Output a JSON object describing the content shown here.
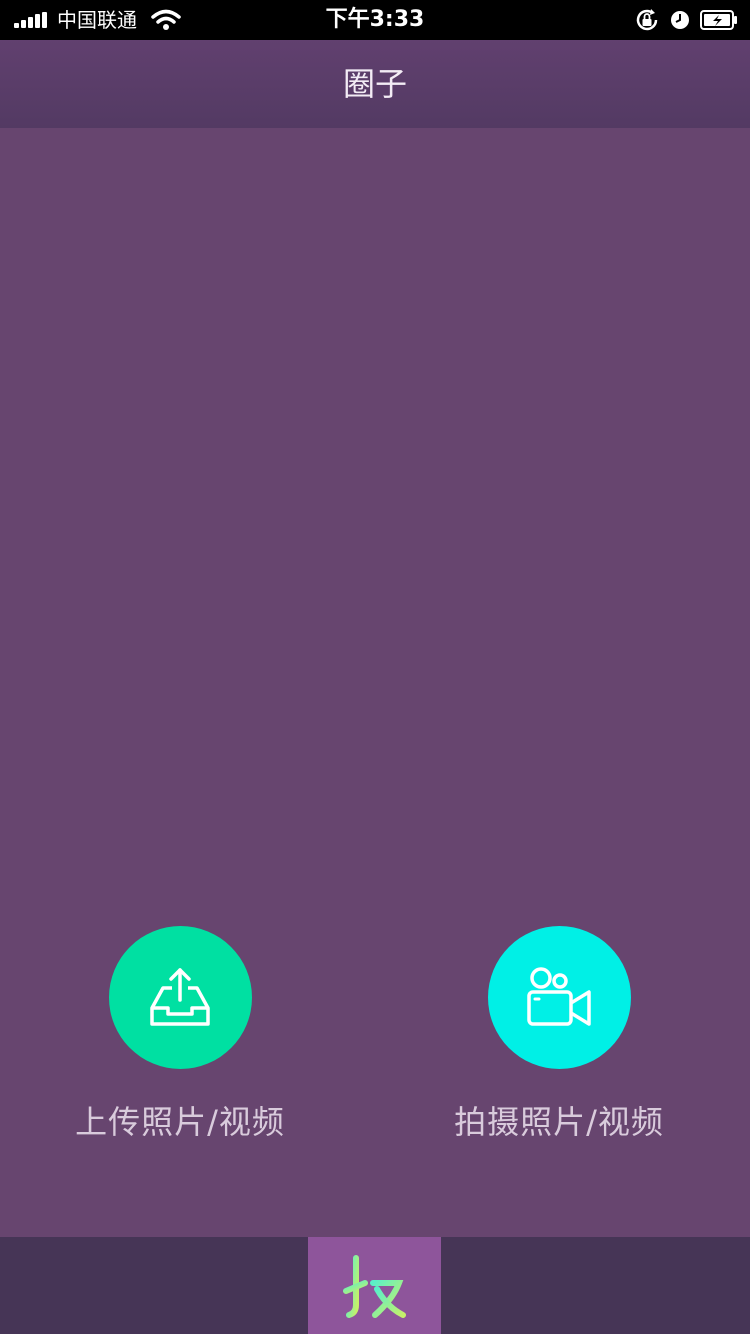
{
  "status_bar": {
    "carrier": "中国联通",
    "time": "下午3:33"
  },
  "nav": {
    "title": "圈子"
  },
  "actions": [
    {
      "label": "上传照片/视频",
      "icon": "upload-tray-icon",
      "color": "#00e0a2"
    },
    {
      "label": "拍摄照片/视频",
      "icon": "video-camera-icon",
      "color": "#00f0e6"
    }
  ],
  "tab_bar": {
    "center_icon": "ji-logo-icon",
    "color": "#8e559b"
  }
}
